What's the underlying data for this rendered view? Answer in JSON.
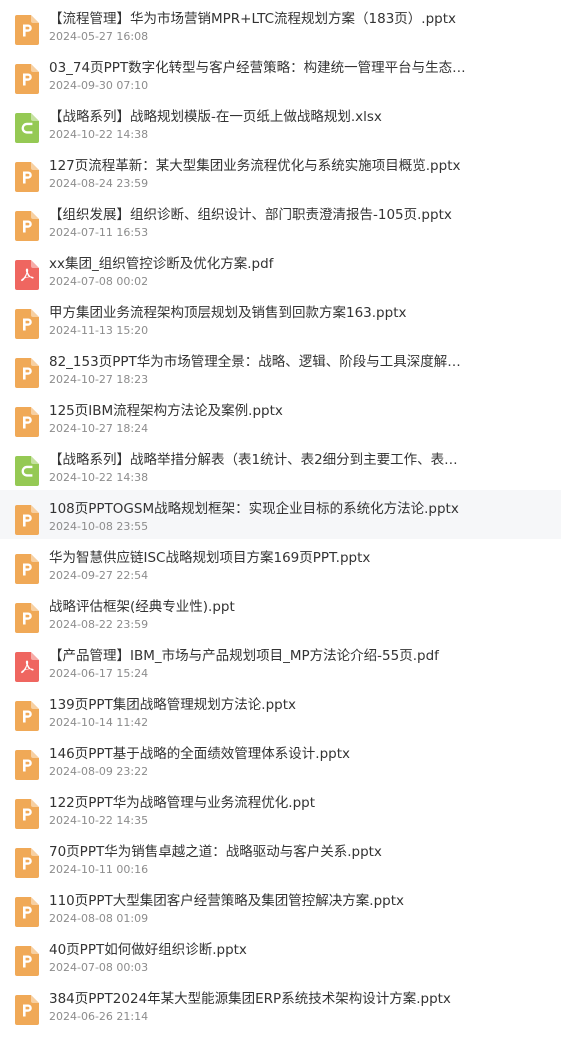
{
  "colors": {
    "pptx": "#f0a957",
    "xlsx": "#95c954",
    "pdf": "#ef6660",
    "row_highlight": "#f6f7f9"
  },
  "files": [
    {
      "name": "【流程管理】华为市场营销MPR+LTC流程规划方案（183页）.pptx",
      "date": "2024-05-27 16:08",
      "icon": "pptx-file-icon"
    },
    {
      "name": "03_74页PPT数字化转型与客户经营策略：构建统一管理平台与生态…",
      "date": "2024-09-30 07:10",
      "icon": "pptx-file-icon"
    },
    {
      "name": "【战略系列】战略规划模版-在一页纸上做战略规划.xlsx",
      "date": "2024-10-22 14:38",
      "icon": "xlsx-file-icon"
    },
    {
      "name": "127页流程革新：某大型集团业务流程优化与系统实施项目概览.pptx",
      "date": "2024-08-24 23:59",
      "icon": "pptx-file-icon"
    },
    {
      "name": "【组织发展】组织诊断、组织设计、部门职责澄清报告-105页.pptx",
      "date": "2024-07-11 16:53",
      "icon": "pptx-file-icon"
    },
    {
      "name": "xx集团_组织管控诊断及优化方案.pdf",
      "date": "2024-07-08 00:02",
      "icon": "pdf-file-icon"
    },
    {
      "name": "甲方集团业务流程架构顶层规划及销售到回款方案163.pptx",
      "date": "2024-11-13 15:20",
      "icon": "pptx-file-icon"
    },
    {
      "name": "82_153页PPT华为市场管理全景：战略、逻辑、阶段与工具深度解…",
      "date": "2024-10-27 18:23",
      "icon": "pptx-file-icon"
    },
    {
      "name": "125页IBM流程架构方法论及案例.pptx",
      "date": "2024-10-27 18:24",
      "icon": "pptx-file-icon"
    },
    {
      "name": "【战略系列】战略举措分解表（表1统计、表2细分到主要工作、表…",
      "date": "2024-10-22 14:38",
      "icon": "xlsx-file-icon"
    },
    {
      "name": "108页PPTOGSM战略规划框架：实现企业目标的系统化方法论.pptx",
      "date": "2024-10-08 23:55",
      "icon": "pptx-file-icon",
      "highlight": true
    },
    {
      "name": "华为智慧供应链ISC战略规划项目方案169页PPT.pptx",
      "date": "2024-09-27 22:54",
      "icon": "pptx-file-icon"
    },
    {
      "name": "战略评估框架(经典专业性).ppt",
      "date": "2024-08-22 23:59",
      "icon": "pptx-file-icon"
    },
    {
      "name": "【产品管理】IBM_市场与产品规划项目_MP方法论介绍-55页.pdf",
      "date": "2024-06-17 15:24",
      "icon": "pdf-file-icon"
    },
    {
      "name": "139页PPT集团战略管理规划方法论.pptx",
      "date": "2024-10-14 11:42",
      "icon": "pptx-file-icon"
    },
    {
      "name": "146页PPT基于战略的全面绩效管理体系设计.pptx",
      "date": "2024-08-09 23:22",
      "icon": "pptx-file-icon"
    },
    {
      "name": "122页PPT华为战略管理与业务流程优化.ppt",
      "date": "2024-10-22 14:35",
      "icon": "pptx-file-icon"
    },
    {
      "name": "70页PPT华为销售卓越之道：战略驱动与客户关系.pptx",
      "date": "2024-10-11 00:16",
      "icon": "pptx-file-icon"
    },
    {
      "name": "110页PPT大型集团客户经营策略及集团管控解决方案.pptx",
      "date": "2024-08-08 01:09",
      "icon": "pptx-file-icon"
    },
    {
      "name": "40页PPT如何做好组织诊断.pptx",
      "date": "2024-07-08 00:03",
      "icon": "pptx-file-icon"
    },
    {
      "name": "384页PPT2024年某大型能源集团ERP系统技术架构设计方案.pptx",
      "date": "2024-06-26 21:14",
      "icon": "pptx-file-icon"
    }
  ]
}
